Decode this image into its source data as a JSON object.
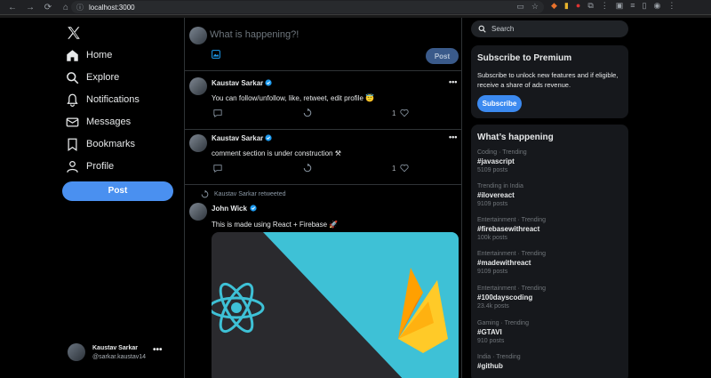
{
  "browser": {
    "url": "localhost:3000"
  },
  "sidebar": {
    "items": [
      {
        "label": "Home",
        "icon": "home-icon"
      },
      {
        "label": "Explore",
        "icon": "search-icon"
      },
      {
        "label": "Notifications",
        "icon": "bell-icon"
      },
      {
        "label": "Messages",
        "icon": "envelope-icon"
      },
      {
        "label": "Bookmarks",
        "icon": "bookmark-icon"
      },
      {
        "label": "Profile",
        "icon": "user-icon"
      }
    ],
    "post_label": "Post",
    "user": {
      "name": "Kaustav Sarkar",
      "handle": "@sarkar.kaustav14"
    }
  },
  "composer": {
    "placeholder": "What is happening?!",
    "post_label": "Post"
  },
  "feed": [
    {
      "name": "Kaustav Sarkar",
      "text": "You can follow/unfollow, like, retweet, edit profile 😇",
      "likes": "1"
    },
    {
      "name": "Kaustav Sarkar",
      "text": "comment section is under construction ⚒",
      "likes": "1"
    },
    {
      "retweeted_by": "Kaustav Sarkar retweeted",
      "name": "John Wick",
      "text": "This is made using React + Firebase 🚀"
    }
  ],
  "search": {
    "placeholder": "Search"
  },
  "premium": {
    "title": "Subscribe to Premium",
    "body": "Subscribe to unlock new features and if eligible, receive a share of ads revenue.",
    "button": "Subscribe"
  },
  "happening": {
    "title": "What’s happening",
    "trends": [
      {
        "context": "Coding · Trending",
        "tag": "#javascript",
        "count": "5109 posts"
      },
      {
        "context": "Trending in India",
        "tag": "#ilovereact",
        "count": "9109 posts"
      },
      {
        "context": "Entertainment · Trending",
        "tag": "#firebasewithreact",
        "count": "100k posts"
      },
      {
        "context": "Entertainment · Trending",
        "tag": "#madewithreact",
        "count": "9109 posts"
      },
      {
        "context": "Entertainment · Trending",
        "tag": "#100dayscoding",
        "count": "23.4k posts"
      },
      {
        "context": "Gaming · Trending",
        "tag": "#GTAVI",
        "count": "910 posts"
      },
      {
        "context": "India · Trending",
        "tag": "#github",
        "count": ""
      }
    ]
  },
  "colors": {
    "accent": "#1d9bf0",
    "post_button": "#4a90f0",
    "background": "#000000",
    "card": "#16181c"
  }
}
